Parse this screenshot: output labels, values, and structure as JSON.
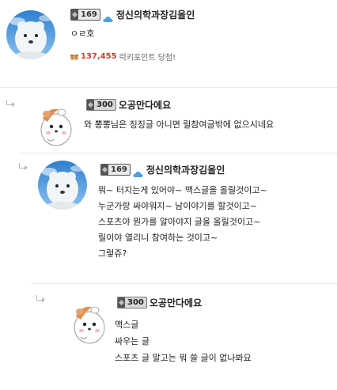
{
  "comments": [
    {
      "level": "169",
      "nickname": "정신의학과장김올인",
      "lines": [
        "ㅇㄹ호"
      ],
      "point_amount": "137,455",
      "point_text": "럭키포인트 당첨!"
    },
    {
      "level": "300",
      "nickname": "오공만다에요",
      "lines": [
        "와 뽕뽕님은 징징글 아니면 릴참여글밖에 없으시네요"
      ]
    },
    {
      "level": "169",
      "nickname": "정신의학과장김올인",
      "lines": [
        "뭐~ 터지는게 있어야~ 맥스글을 올릴것이고~",
        "누군가랑 싸야워지~ 남이야기를 할것이고~",
        "스포츠야 뭔가를 알아야지 글을 올릴것이고~",
        "릴이야 열리니 참여하는 것이고~",
        "그렇쥬?"
      ]
    },
    {
      "level": "300",
      "nickname": "오공만다에요",
      "lines": [
        "맥스글",
        "싸우는 글",
        "스포츠 글 말고는 뭐 쓸 글이 없나봐요"
      ]
    }
  ]
}
